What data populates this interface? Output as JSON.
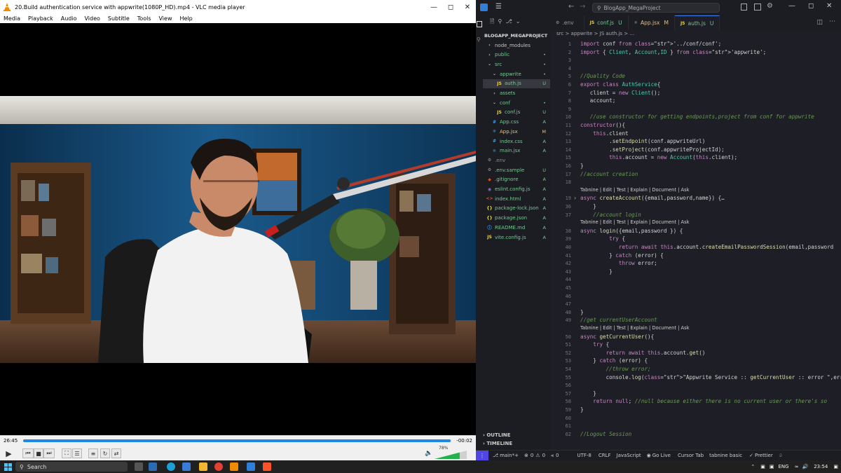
{
  "vlc": {
    "title": "20.Build authentication service with appwrite(1080P_HD).mp4 - VLC media player",
    "menu": [
      "Media",
      "Playback",
      "Audio",
      "Video",
      "Subtitle",
      "Tools",
      "View",
      "Help"
    ],
    "elapsed": "26:45",
    "remaining": "-00:02",
    "progress": 0.999,
    "volume_label": "78%",
    "volume": 0.78
  },
  "vscode": {
    "command_center": "BlogApp_MegaProject",
    "explorer_title": "BLOGAPP_MEGAPROJECT",
    "tree": [
      {
        "label": "node_modules",
        "type": "folder",
        "indent": 0,
        "status": "",
        "color": "#c5c5c5"
      },
      {
        "label": "public",
        "type": "folder",
        "indent": 0,
        "status": "•",
        "color": "#73c991"
      },
      {
        "label": "src",
        "type": "folder-open",
        "indent": 0,
        "status": "•",
        "color": "#73c991"
      },
      {
        "label": "appwrite",
        "type": "folder-open",
        "indent": 1,
        "status": "•",
        "color": "#73c991"
      },
      {
        "label": "auth.js",
        "type": "js",
        "indent": 2,
        "status": "U",
        "color": "#73c991",
        "selected": true
      },
      {
        "label": "assets",
        "type": "folder",
        "indent": 1,
        "status": "",
        "color": "#73c991"
      },
      {
        "label": "conf",
        "type": "folder-open",
        "indent": 1,
        "status": "•",
        "color": "#73c991"
      },
      {
        "label": "conf.js",
        "type": "js",
        "indent": 2,
        "status": "U",
        "color": "#73c991"
      },
      {
        "label": "App.css",
        "type": "css",
        "indent": 1,
        "status": "A",
        "color": "#73c991"
      },
      {
        "label": "App.jsx",
        "type": "react",
        "indent": 1,
        "status": "M",
        "color": "#e2c08d"
      },
      {
        "label": "index.css",
        "type": "css",
        "indent": 1,
        "status": "A",
        "color": "#73c991"
      },
      {
        "label": "main.jsx",
        "type": "react",
        "indent": 1,
        "status": "A",
        "color": "#73c991"
      },
      {
        "label": ".env",
        "type": "env",
        "indent": 0,
        "status": "",
        "color": "#8b8b8b"
      },
      {
        "label": ".env.sample",
        "type": "env",
        "indent": 0,
        "status": "U",
        "color": "#73c991"
      },
      {
        "label": ".gitignore",
        "type": "git",
        "indent": 0,
        "status": "A",
        "color": "#73c991"
      },
      {
        "label": "eslint.config.js",
        "type": "eslint",
        "indent": 0,
        "status": "A",
        "color": "#73c991"
      },
      {
        "label": "index.html",
        "type": "html",
        "indent": 0,
        "status": "A",
        "color": "#73c991"
      },
      {
        "label": "package-lock.json",
        "type": "json",
        "indent": 0,
        "status": "A",
        "color": "#73c991"
      },
      {
        "label": "package.json",
        "type": "json",
        "indent": 0,
        "status": "A",
        "color": "#73c991"
      },
      {
        "label": "README.md",
        "type": "md",
        "indent": 0,
        "status": "A",
        "color": "#73c991"
      },
      {
        "label": "vite.config.js",
        "type": "js",
        "indent": 0,
        "status": "A",
        "color": "#73c991"
      }
    ],
    "tabs": [
      {
        "label": ".env",
        "badge": "",
        "icon": "gear",
        "active": false
      },
      {
        "label": "conf.js",
        "badge": "U",
        "icon": "js",
        "active": false
      },
      {
        "label": "App.jsx",
        "badge": "M",
        "icon": "react",
        "active": false
      },
      {
        "label": "auth.js",
        "badge": "U",
        "icon": "js",
        "active": true
      }
    ],
    "breadcrumbs": "src > appwrite > JS auth.js > ...",
    "code_lines": [
      {
        "n": "1",
        "t": "import conf from '../conf/conf';"
      },
      {
        "n": "2",
        "t": "import { Client, Account,ID } from 'appwrite';"
      },
      {
        "n": "3",
        "t": ""
      },
      {
        "n": "4",
        "t": ""
      },
      {
        "n": "5",
        "t": "//Quality Code"
      },
      {
        "n": "6",
        "t": "export class AuthService{"
      },
      {
        "n": "7",
        "t": "   client = new Client();"
      },
      {
        "n": "8",
        "t": "   account;"
      },
      {
        "n": "9",
        "t": ""
      },
      {
        "n": "10",
        "t": "   //use constructor for getting endpoints,project from conf for appwrite"
      },
      {
        "n": "11",
        "t": "constructor(){"
      },
      {
        "n": "12",
        "t": "    this.client"
      },
      {
        "n": "13",
        "t": "         .setEndpoint(conf.appwriteUrl)"
      },
      {
        "n": "14",
        "t": "         .setProject(conf.appwriteProjectId);"
      },
      {
        "n": "15",
        "t": "         this.account = new Account(this.client);"
      },
      {
        "n": "16",
        "t": "}"
      },
      {
        "n": "17",
        "t": "//account creation"
      },
      {
        "n": "18",
        "t": ""
      },
      {
        "n": "",
        "t": "Tabnine | Edit | Test | Explain | Document | Ask",
        "lens": true
      },
      {
        "n": "19",
        "t": "async createAccount({email,password,name}) {…"
      },
      {
        "n": "36",
        "t": "    }"
      },
      {
        "n": "37",
        "t": "    //account login"
      },
      {
        "n": "",
        "t": "Tabnine | Edit | Test | Explain | Document | Ask",
        "lens": true
      },
      {
        "n": "38",
        "t": "async login({email,password }) {"
      },
      {
        "n": "39",
        "t": "         try {"
      },
      {
        "n": "40",
        "t": "            return await this.account.createEmailPasswordSession(email,password"
      },
      {
        "n": "41",
        "t": "         } catch (error) {"
      },
      {
        "n": "42",
        "t": "            throw error;"
      },
      {
        "n": "43",
        "t": "         }"
      },
      {
        "n": "44",
        "t": ""
      },
      {
        "n": "45",
        "t": ""
      },
      {
        "n": "46",
        "t": ""
      },
      {
        "n": "47",
        "t": ""
      },
      {
        "n": "48",
        "t": "}"
      },
      {
        "n": "49",
        "t": "//get currentUserAccount"
      },
      {
        "n": "",
        "t": "Tabnine | Edit | Test | Explain | Document | Ask",
        "lens": true
      },
      {
        "n": "50",
        "t": "async getCurrentUser(){"
      },
      {
        "n": "51",
        "t": "    try {"
      },
      {
        "n": "52",
        "t": "        return await this.account.get()"
      },
      {
        "n": "53",
        "t": "    } catch (error) {"
      },
      {
        "n": "54",
        "t": "        //throw error;"
      },
      {
        "n": "55",
        "t": "        console.log(\"Appwrite Service :: getCurrentUser :: error \",error);"
      },
      {
        "n": "56",
        "t": ""
      },
      {
        "n": "57",
        "t": "    }"
      },
      {
        "n": "58",
        "t": "    return null; //null because either there is no current user or there's so"
      },
      {
        "n": "59",
        "t": "}"
      },
      {
        "n": "60",
        "t": ""
      },
      {
        "n": "61",
        "t": ""
      },
      {
        "n": "62",
        "t": "//Logout Session"
      }
    ],
    "outline_label": "OUTLINE",
    "timeline_label": "TIMELINE",
    "status": {
      "branch": "main*+",
      "errors": "0",
      "warnings": "0",
      "ports": "0",
      "encoding": "UTF-8",
      "eol": "CRLF",
      "language": "JavaScript",
      "golive": "Go Live",
      "cursortab": "Cursor Tab",
      "tabnine": "tabnine basic",
      "prettier": "Prettier"
    }
  },
  "taskbar": {
    "search": "Search",
    "lang": "ENG",
    "time": "23:54"
  },
  "colors": {
    "vlc_seek": "#1e88e5",
    "vscode_bg": "#1e1f26",
    "keyword": "#c586c0",
    "function": "#dcdcaa",
    "string": "#ce9178",
    "comment": "#6a9955"
  }
}
